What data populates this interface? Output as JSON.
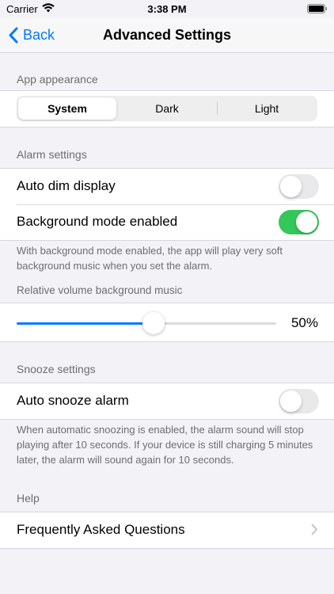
{
  "status_bar": {
    "carrier": "Carrier",
    "time": "3:38 PM"
  },
  "nav": {
    "back_label": "Back",
    "title": "Advanced Settings"
  },
  "app_appearance": {
    "header": "App appearance",
    "segments": [
      "System",
      "Dark",
      "Light"
    ],
    "selected": "System"
  },
  "alarm_settings": {
    "header": "Alarm settings",
    "auto_dim_label": "Auto dim display",
    "auto_dim_on": false,
    "background_mode_label": "Background mode enabled",
    "background_mode_on": true,
    "footer": "With background mode enabled, the app will play very soft background music when you set the alarm.",
    "volume_header": "Relative volume background music",
    "volume_percent": 50,
    "volume_label": "50%"
  },
  "snooze_settings": {
    "header": "Snooze settings",
    "auto_snooze_label": "Auto snooze alarm",
    "auto_snooze_on": false,
    "footer": "When automatic snoozing is enabled, the alarm sound will stop playing after 10 seconds. If your device is still charging 5 minutes later, the alarm will sound again for 10 seconds."
  },
  "help": {
    "header": "Help",
    "faq_label": "Frequently Asked Questions"
  },
  "colors": {
    "accent": "#007aff",
    "toggle_on": "#34c759",
    "toggle_off": "#e9e9eb",
    "background": "#f2f2f7"
  },
  "icons": {
    "wifi": "wifi-icon",
    "battery": "battery-icon",
    "back": "chevron-left-icon",
    "disclosure": "chevron-right-icon"
  }
}
